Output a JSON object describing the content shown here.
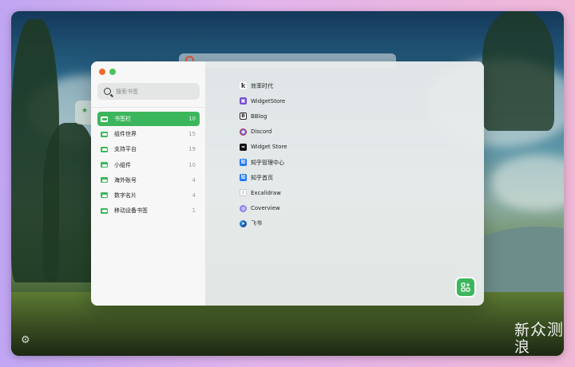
{
  "app": {
    "window_controls": [
      "close",
      "zoom"
    ]
  },
  "search": {
    "placeholder": "搜索书签"
  },
  "folders": [
    {
      "name": "书签栏",
      "count": "10",
      "active": true
    },
    {
      "name": "组件世界",
      "count": "15"
    },
    {
      "name": "支持平台",
      "count": "19"
    },
    {
      "name": "小组件",
      "count": "10"
    },
    {
      "name": "海外账号",
      "count": "4"
    },
    {
      "name": "数字名片",
      "count": "4"
    },
    {
      "name": "移动设备书签",
      "count": "1"
    }
  ],
  "bookmarks": [
    {
      "label": "效率时代",
      "icon": "efficiency-era-icon",
      "color": "#333333"
    },
    {
      "label": "WidgetStore",
      "icon": "widgetstore-icon",
      "color": "#7b4fd6"
    },
    {
      "label": "BBlog",
      "icon": "bblog-icon",
      "color": "#2a2a2a"
    },
    {
      "label": "Discord",
      "icon": "discord-icon",
      "color": "#5865f2"
    },
    {
      "label": "Widget Store",
      "icon": "widget-store-icon",
      "color": "#111111"
    },
    {
      "label": "知乎管理中心",
      "icon": "zhihu-icon",
      "color": "#1772f6"
    },
    {
      "label": "知乎首页",
      "icon": "zhihu-icon",
      "color": "#1772f6"
    },
    {
      "label": "Excalidraw",
      "icon": "excalidraw-icon",
      "color": "#8a8a8a"
    },
    {
      "label": "Coverview",
      "icon": "coverview-icon",
      "color": "#8e7ff0"
    },
    {
      "label": "飞书",
      "icon": "feishu-icon",
      "color": "#1f9ef0"
    }
  ],
  "colors": {
    "accent": "#3cb65c",
    "close": "#f26b2f",
    "zoom": "#4cc25a"
  },
  "watermark": {
    "line1": "新",
    "line2": "浪",
    "text": "众测"
  }
}
